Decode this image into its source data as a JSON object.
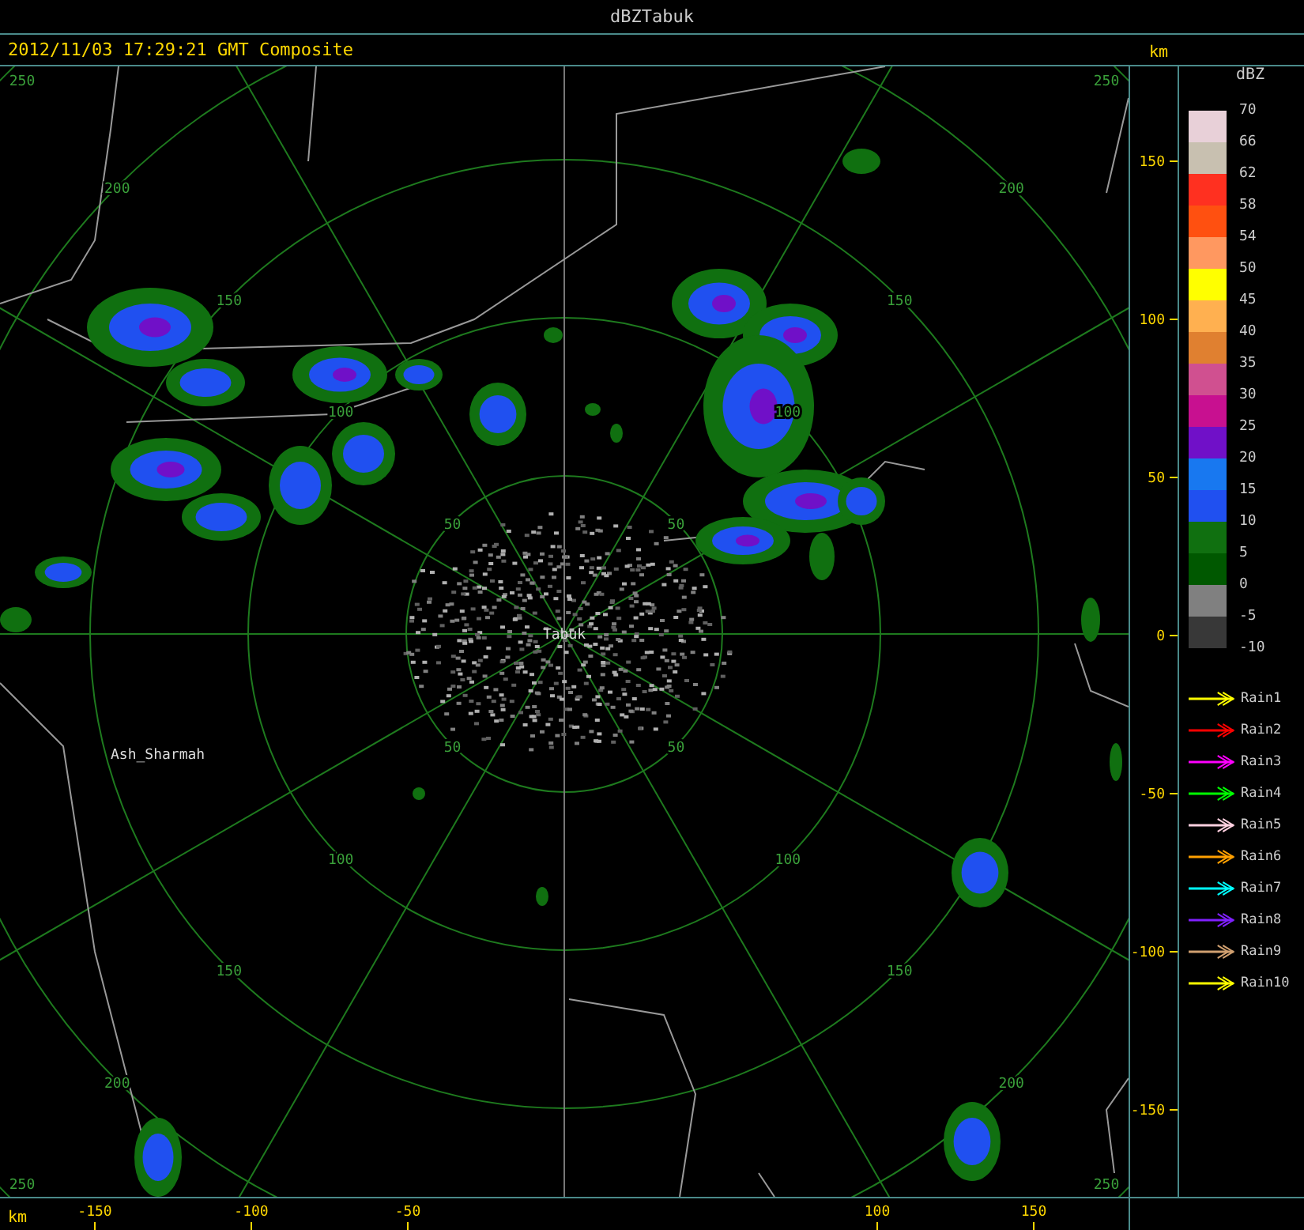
{
  "window": {
    "title": "dBZTabuk"
  },
  "caption": "2012/11/03 17:29:21 GMT Composite",
  "map": {
    "places": [
      {
        "name": "Tabuk"
      },
      {
        "name": "Ash_Sharmah"
      }
    ],
    "rings": [
      {
        "labels": [
          "50",
          "50",
          "50",
          "50"
        ]
      },
      {
        "labels": [
          "100",
          "100",
          "100",
          "100"
        ]
      },
      {
        "labels": [
          "150",
          "150",
          "150",
          "150"
        ]
      },
      {
        "labels": [
          "200",
          "200",
          "200",
          "200"
        ]
      },
      {
        "labels": [
          "250",
          "250",
          "250",
          "250"
        ]
      }
    ]
  },
  "y_axis": {
    "unit": "km",
    "ticks": [
      "150",
      "100",
      "50",
      "0",
      "-50",
      "-100",
      "-150"
    ]
  },
  "x_axis": {
    "unit": "km",
    "ticks": [
      "-150",
      "-100",
      "-50",
      "100",
      "150"
    ]
  },
  "legend": {
    "title": "dBZ",
    "bands": [
      {
        "color": "#e8d0d8"
      },
      {
        "color": "#c8c0b0"
      },
      {
        "color": "#ff3020"
      },
      {
        "color": "#ff5010"
      },
      {
        "color": "#ff9860"
      },
      {
        "color": "#ffff00"
      },
      {
        "color": "#ffb050"
      },
      {
        "color": "#e08030"
      },
      {
        "color": "#d05090"
      },
      {
        "color": "#c81090"
      },
      {
        "color": "#7010c8"
      },
      {
        "color": "#1878f0"
      },
      {
        "color": "#2050f0"
      },
      {
        "color": "#107010"
      },
      {
        "color": "#005800"
      },
      {
        "color": "#808080"
      },
      {
        "color": "#383838"
      }
    ],
    "labels": [
      "70",
      "66",
      "62",
      "58",
      "54",
      "50",
      "45",
      "40",
      "35",
      "30",
      "25",
      "20",
      "15",
      "10",
      "5",
      "0",
      "-5",
      "-10"
    ]
  },
  "tracks": [
    {
      "label": "Rain1",
      "color": "#ffff00"
    },
    {
      "label": "Rain2",
      "color": "#ff0000"
    },
    {
      "label": "Rain3",
      "color": "#ff00ff"
    },
    {
      "label": "Rain4",
      "color": "#00ff00"
    },
    {
      "label": "Rain5",
      "color": "#ffd0e0"
    },
    {
      "label": "Rain6",
      "color": "#ffa000"
    },
    {
      "label": "Rain7",
      "color": "#00ffff"
    },
    {
      "label": "Rain8",
      "color": "#8020ff"
    },
    {
      "label": "Rain9",
      "color": "#d0a070"
    },
    {
      "label": "Rain10",
      "color": "#ffff00"
    }
  ]
}
